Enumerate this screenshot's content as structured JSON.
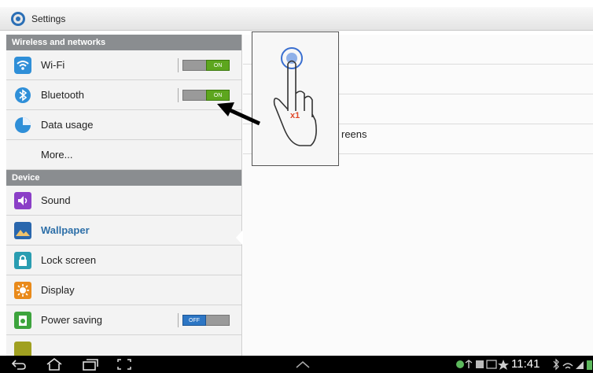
{
  "app": {
    "title": "Settings"
  },
  "sidebar": {
    "sections": [
      {
        "header": "Wireless and networks"
      },
      {
        "header": "Device"
      }
    ],
    "wifi": {
      "label": "Wi-Fi",
      "toggle": "ON"
    },
    "bluetooth": {
      "label": "Bluetooth",
      "toggle": "ON"
    },
    "data_usage": {
      "label": "Data usage"
    },
    "more": {
      "label": "More..."
    },
    "sound": {
      "label": "Sound"
    },
    "wallpaper": {
      "label": "Wallpaper"
    },
    "lock_screen": {
      "label": "Lock screen"
    },
    "display": {
      "label": "Display"
    },
    "power_saving": {
      "label": "Power saving",
      "toggle": "OFF"
    }
  },
  "content": {
    "partial_label": "reens"
  },
  "overlay": {
    "tap_count": "x1"
  },
  "statusbar": {
    "time": "11:41"
  },
  "colors": {
    "on": "#5da61e",
    "off": "#2d76c4",
    "selected_text": "#2d6fa8"
  }
}
